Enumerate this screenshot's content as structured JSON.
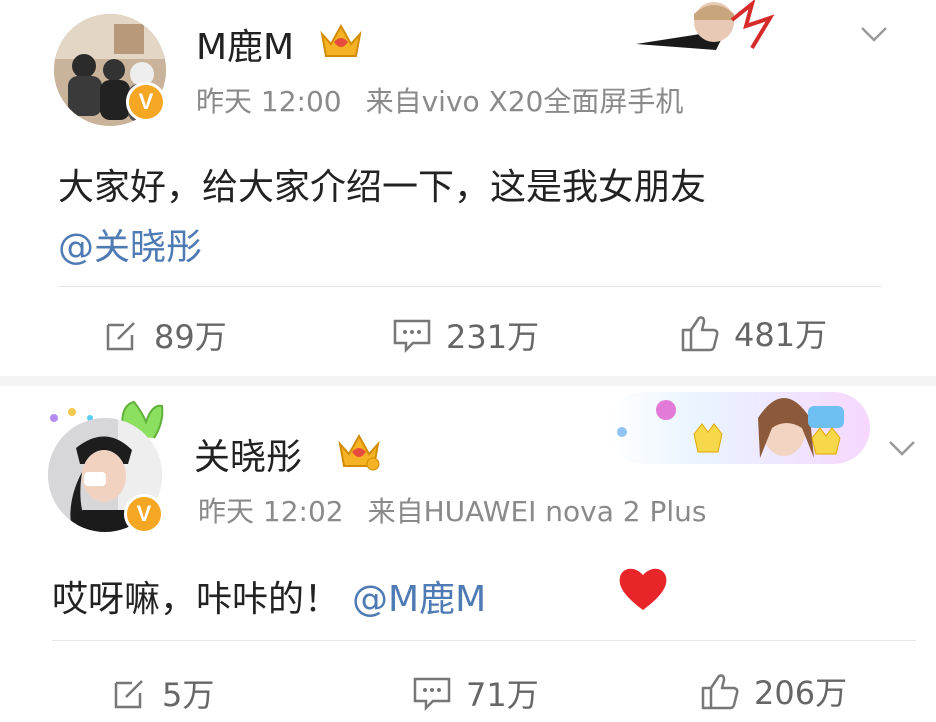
{
  "post1": {
    "author": "M鹿M",
    "time": "昨天 12:00",
    "source": "来自vivo X20全面屏手机",
    "text_line1": "大家好，给大家介绍一下，这是我女朋友",
    "mention": "@关晓彤",
    "actions": {
      "repost": "89万",
      "comment": "231万",
      "like": "481万"
    }
  },
  "post2": {
    "author": "关晓彤",
    "time": "昨天 12:02",
    "source": "来自HUAWEI nova 2 Plus",
    "text": "哎呀嘛，咔咔的！",
    "mention": "@M鹿M",
    "actions": {
      "repost": "5万",
      "comment": "71万",
      "like": "206万"
    }
  },
  "verified_badge": "V",
  "icons": {
    "verified": "verified-v-icon",
    "crown": "vip-crown-icon",
    "repost": "repost-icon",
    "comment": "comment-icon",
    "like": "thumbs-up-icon",
    "more": "chevron-down-icon",
    "heart": "red-heart-icon"
  },
  "colors": {
    "mention": "#4f7bb5",
    "badge": "#f5a623",
    "heart": "#e8262a",
    "meta": "#8a8a8a"
  }
}
